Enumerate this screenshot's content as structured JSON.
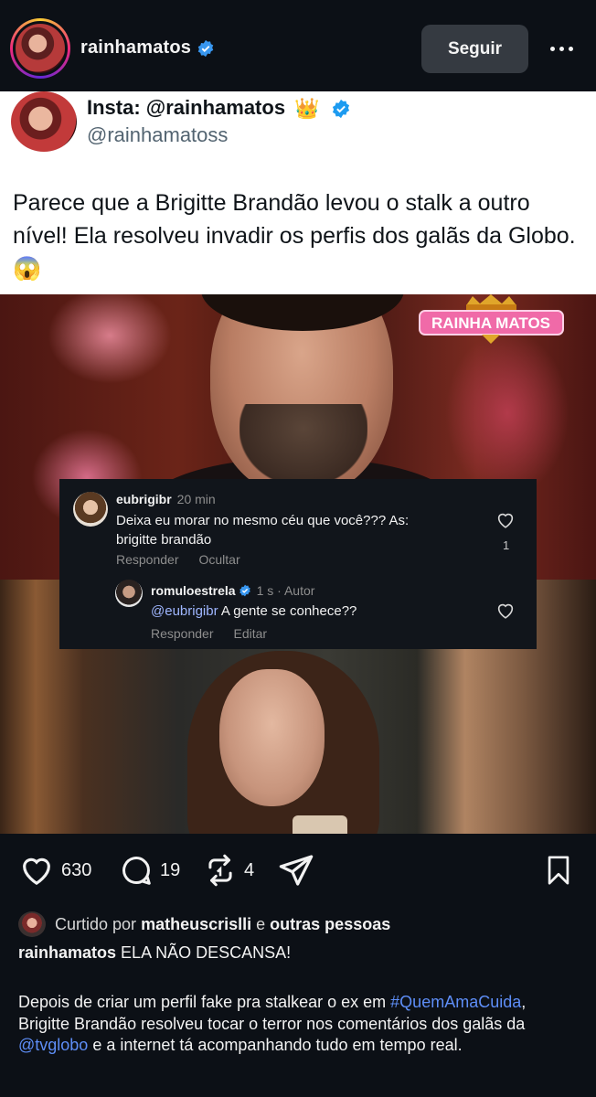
{
  "header": {
    "username": "rainhamatos",
    "follow_label": "Seguir"
  },
  "tweet": {
    "display_name": "Insta: @rainhamatos",
    "crown_emoji": "👑",
    "handle": "@rainhamatoss",
    "text": "Parece que a Brigitte Brandão levou o stalk a outro nível! Ela resolveu invadir os perfis dos galãs da Globo. 😱"
  },
  "media": {
    "logo_text": "RAINHA MATOS",
    "comments": [
      {
        "user": "eubrigibr",
        "time": "20 min",
        "text": "Deixa eu morar no mesmo céu que você??? As: brigitte brandão",
        "likes": "1",
        "actions": [
          "Responder",
          "Ocultar"
        ]
      },
      {
        "user": "romuloestrela",
        "time": "1 s · Autor",
        "mention": "@eubrigibr",
        "text": " A gente se conhece??",
        "actions": [
          "Responder",
          "Editar"
        ]
      }
    ]
  },
  "actions": {
    "likes": "630",
    "comments": "19",
    "reposts": "4"
  },
  "caption": {
    "liked_prefix": "Curtido por ",
    "liked_user": "matheuscrislli",
    "liked_middle": " e ",
    "liked_suffix": "outras pessoas",
    "author": "rainhamatos",
    "headline": " ELA NÃO DESCANSA!",
    "body_1": "Depois de criar um perfil fake pra stalkear o ex em ",
    "hashtag": "#QuemAmaCuida",
    "body_2": ", Brigitte Brandão resolveu tocar o terror nos comentários dos galãs da ",
    "mention": "@tvglobo",
    "body_3": "  e a internet tá acompanhando tudo em tempo real."
  },
  "colors": {
    "background": "#0c1016",
    "verified": "#3897f0",
    "link": "#5e8ef7",
    "button": "#353a41"
  },
  "icons": [
    "verified-icon",
    "more-icon",
    "heart-icon",
    "comment-icon",
    "repost-icon",
    "share-icon",
    "bookmark-icon"
  ]
}
